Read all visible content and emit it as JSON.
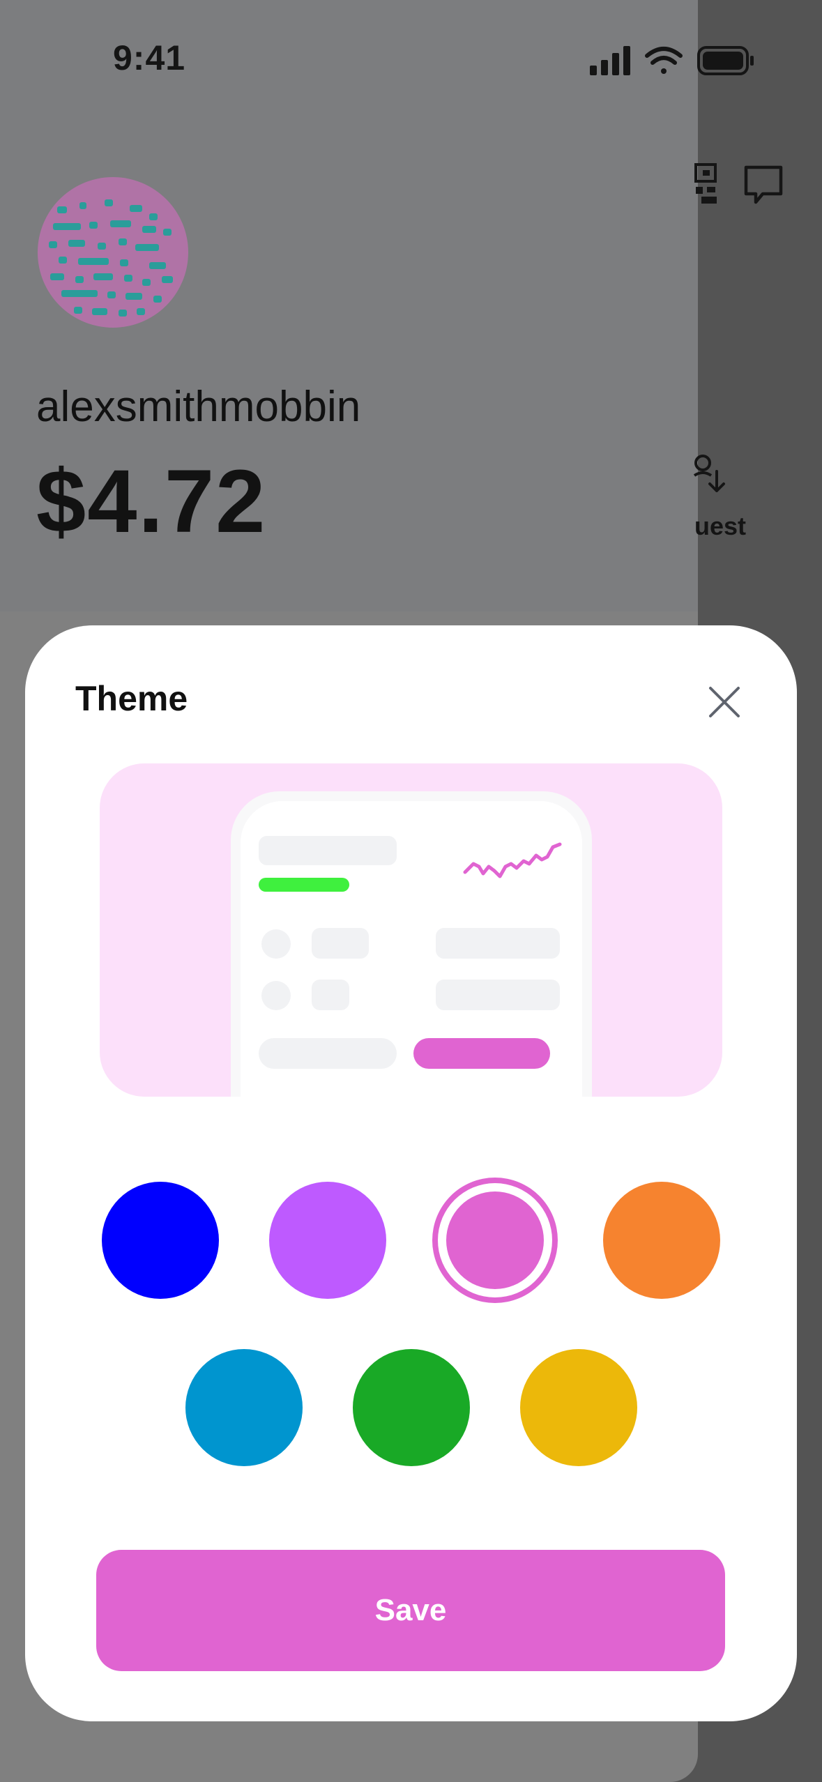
{
  "status_bar": {
    "time": "9:41"
  },
  "profile": {
    "username": "alexsmithmobbin",
    "balance": "$4.72",
    "request_label": "uest"
  },
  "theme_sheet": {
    "title": "Theme",
    "save_label": "Save",
    "accent": "#e064d1",
    "swatches": [
      {
        "name": "blue",
        "color": "#0000ff"
      },
      {
        "name": "purple",
        "color": "#be5aff"
      },
      {
        "name": "pink",
        "color": "#e064d1",
        "selected": true
      },
      {
        "name": "orange",
        "color": "#f6832f"
      },
      {
        "name": "cyan",
        "color": "#0095cf"
      },
      {
        "name": "green",
        "color": "#19a926"
      },
      {
        "name": "yellow",
        "color": "#ecb80a"
      }
    ],
    "preview": {
      "background": "#fce0fa",
      "highlight": "#3ff03e",
      "line_color": "#e064d1"
    }
  },
  "icons": {
    "qr": "qr-code-icon",
    "chat": "chat-icon",
    "close": "close-icon",
    "request": "request-arrow-icon"
  }
}
